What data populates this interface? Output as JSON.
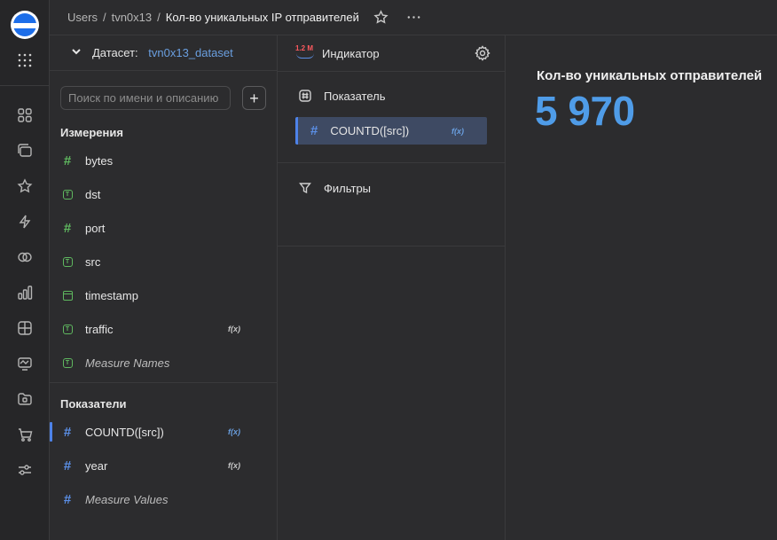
{
  "breadcrumb": {
    "items": [
      "Users",
      "tvn0x13"
    ],
    "separator": "/",
    "current": "Кол-во уникальных IP отправителей"
  },
  "rail": {
    "icons": [
      "grid-icon",
      "dashboards-icon",
      "star-icon",
      "bolt-icon",
      "connections-icon",
      "charts-icon",
      "datasets-icon",
      "monitor-icon",
      "folder-icon",
      "cart-icon",
      "settings-sliders-icon"
    ]
  },
  "dataset": {
    "label": "Датасет:",
    "name": "tvn0x13_dataset",
    "search_placeholder": "Поиск по имени и описанию",
    "add_label": "+",
    "dimensions_title": "Измерения",
    "dimensions": [
      {
        "name": "bytes",
        "type": "number",
        "fx": ""
      },
      {
        "name": "dst",
        "type": "string",
        "fx": ""
      },
      {
        "name": "port",
        "type": "number",
        "fx": ""
      },
      {
        "name": "src",
        "type": "string",
        "fx": ""
      },
      {
        "name": "timestamp",
        "type": "date",
        "fx": ""
      },
      {
        "name": "traffic",
        "type": "string",
        "fx": "f(x)"
      },
      {
        "name": "Measure Names",
        "type": "string",
        "fx": ""
      }
    ],
    "measures_title": "Показатели",
    "measures": [
      {
        "name": "COUNTD([src])",
        "fx": "f(x)"
      },
      {
        "name": "year",
        "fx": "f(x)"
      },
      {
        "name": "Measure Values",
        "fx": ""
      }
    ]
  },
  "wizard": {
    "vis_badge": "1.2 M",
    "vis_title": "Индикатор",
    "measure_section": "Показатель",
    "measure_item": "COUNTD([src])",
    "measure_fx": "f(x)",
    "filters_section": "Фильтры"
  },
  "preview": {
    "title": "Кол-во уникальных отправителей",
    "value": "5 970"
  },
  "colors": {
    "accent": "#4d82e8",
    "value_blue": "#4f9ce8",
    "dimension_green": "#5fb85f",
    "background": "#2c2c2e"
  }
}
